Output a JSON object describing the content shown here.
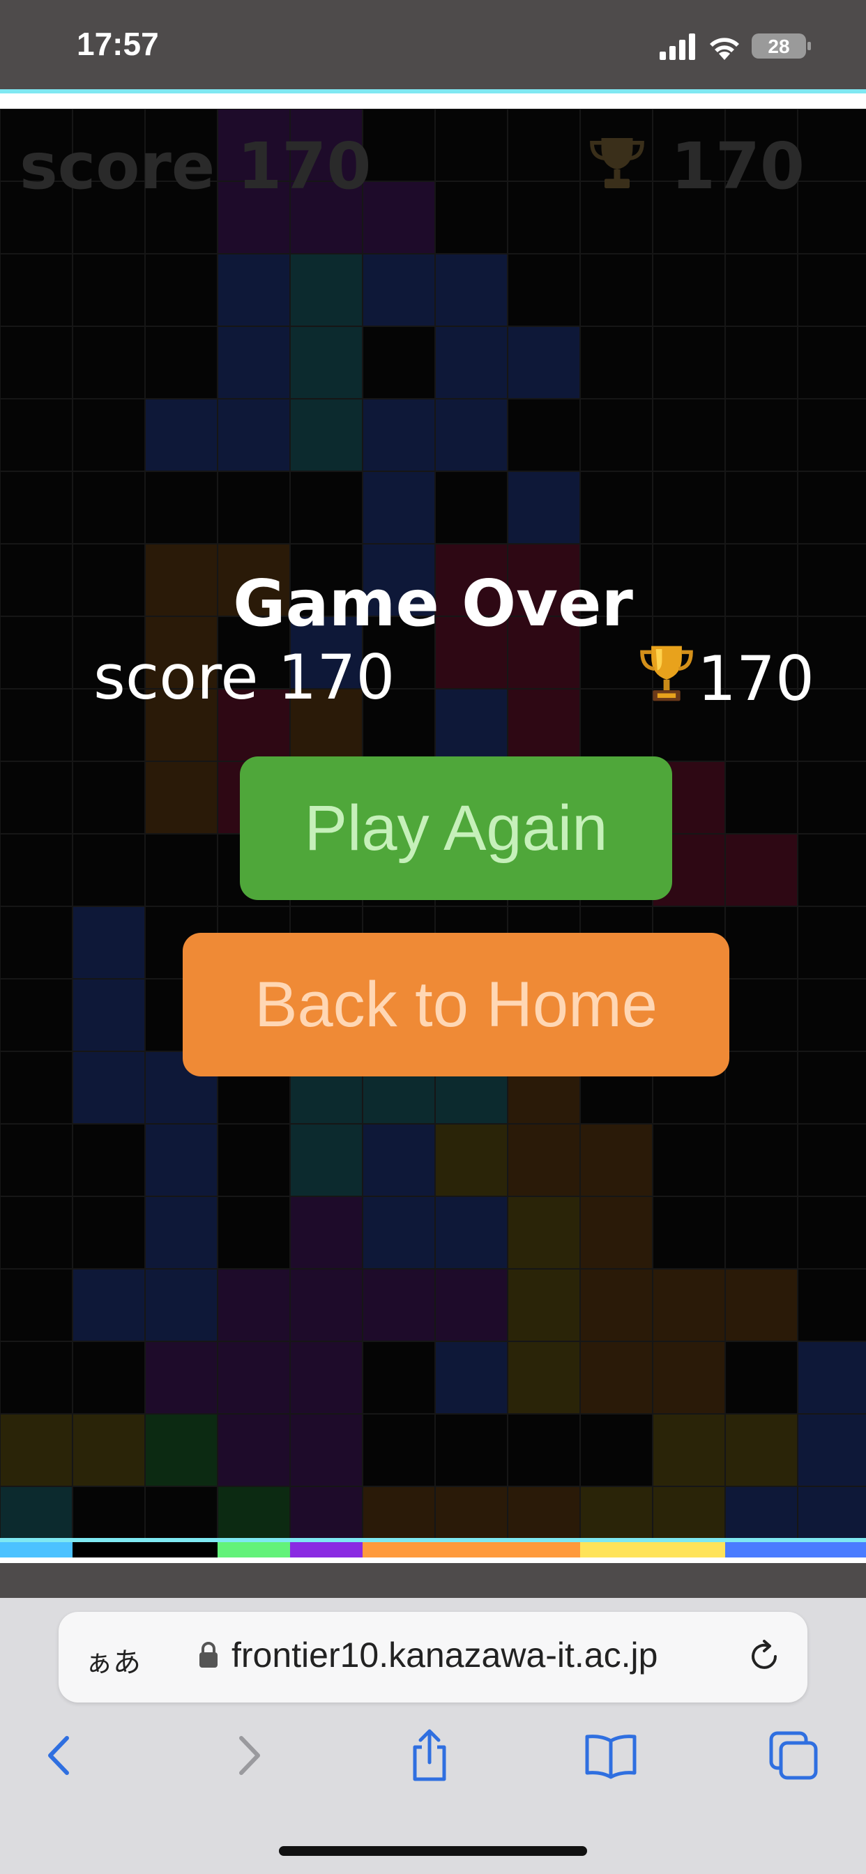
{
  "status_bar": {
    "time": "17:57",
    "battery": "28"
  },
  "hud": {
    "score_text": "score 170",
    "best_value": "170"
  },
  "game_over": {
    "title": "Game Over",
    "score_text": "score 170",
    "best_value": "170",
    "play_again_label": "Play Again",
    "back_home_label": "Back to Home"
  },
  "browser": {
    "aa_label": "ぁあ",
    "url": "frontier10.kanazawa-it.ac.jp"
  },
  "colors": {
    "play_again": "#4fa73a",
    "back_home": "#ef8a36",
    "accent_cyan": "#7fe8f2"
  }
}
